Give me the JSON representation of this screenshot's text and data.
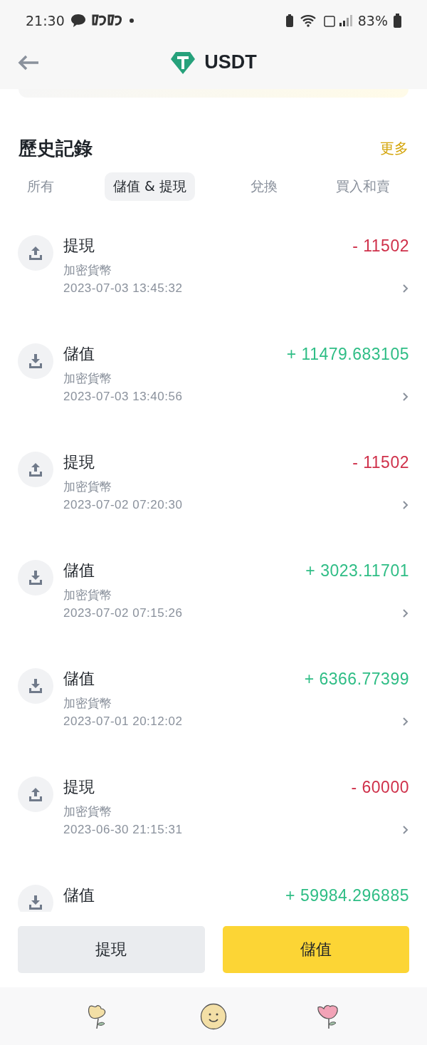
{
  "status_bar": {
    "time": "21:30",
    "battery": "83%"
  },
  "header": {
    "title": "USDT"
  },
  "history": {
    "title": "歷史記錄",
    "more": "更多"
  },
  "tabs": [
    {
      "label": "所有",
      "selected": false
    },
    {
      "label": "儲值 & 提現",
      "selected": true
    },
    {
      "label": "兌換",
      "selected": false
    },
    {
      "label": "買入和賣",
      "selected": false
    }
  ],
  "transactions": [
    {
      "kind": "withdraw",
      "title": "提現",
      "amount": "- 11502",
      "category": "加密貨幣",
      "time": "2023-07-03 13:45:32"
    },
    {
      "kind": "deposit",
      "title": "儲值",
      "amount": "+ 11479.683105",
      "category": "加密貨幣",
      "time": "2023-07-03 13:40:56"
    },
    {
      "kind": "withdraw",
      "title": "提現",
      "amount": "- 11502",
      "category": "加密貨幣",
      "time": "2023-07-02 07:20:30"
    },
    {
      "kind": "deposit",
      "title": "儲值",
      "amount": "+ 3023.11701",
      "category": "加密貨幣",
      "time": "2023-07-02 07:15:26"
    },
    {
      "kind": "deposit",
      "title": "儲值",
      "amount": "+ 6366.77399",
      "category": "加密貨幣",
      "time": "2023-07-01 20:12:02"
    },
    {
      "kind": "withdraw",
      "title": "提現",
      "amount": "- 60000",
      "category": "加密貨幣",
      "time": "2023-06-30 21:15:31"
    },
    {
      "kind": "deposit",
      "title": "儲值",
      "amount": "+ 59984.296885"
    }
  ],
  "actions": [
    {
      "kind": "secondary",
      "label": "提現"
    },
    {
      "kind": "primary",
      "label": "儲值"
    }
  ]
}
